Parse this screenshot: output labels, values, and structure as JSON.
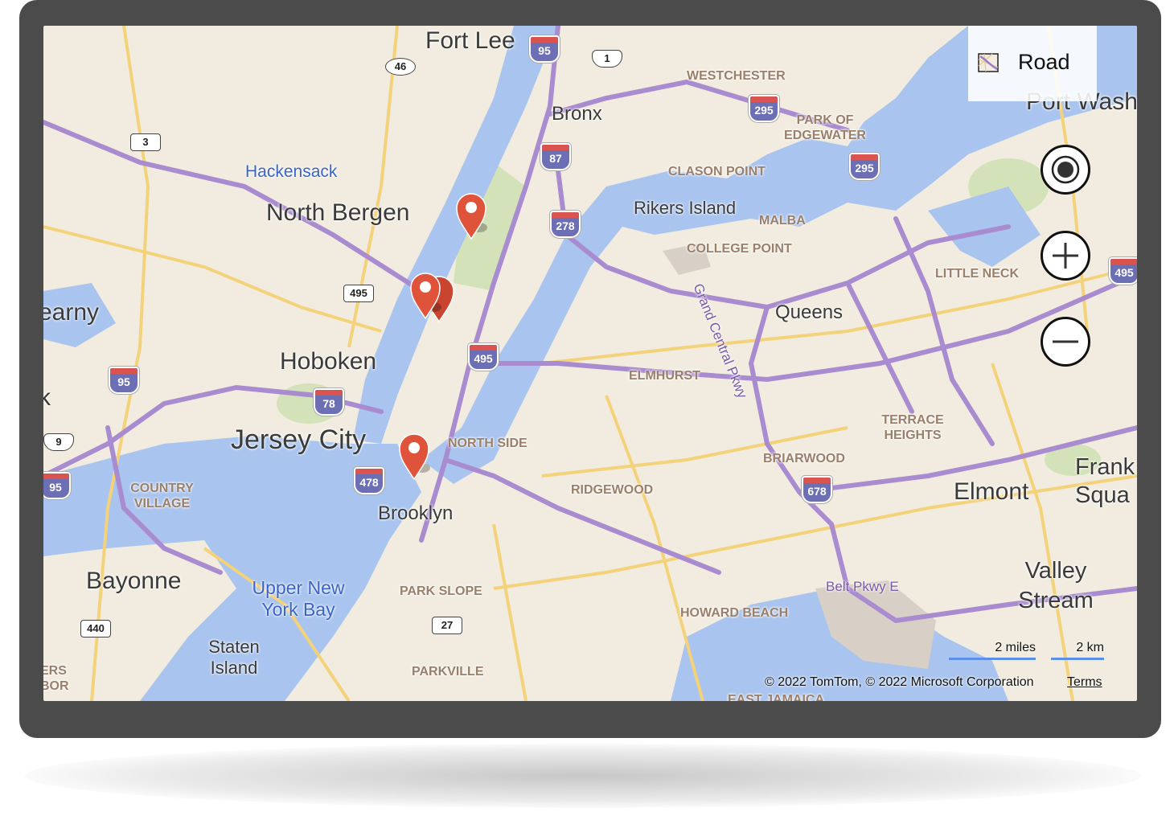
{
  "map": {
    "style_label": "Road",
    "style_icon": "road-map-style-icon",
    "controls": [
      {
        "name": "locate-me-button",
        "icon": "target-icon"
      },
      {
        "name": "zoom-in-button",
        "icon": "plus-icon"
      },
      {
        "name": "zoom-out-button",
        "icon": "minus-icon"
      }
    ],
    "cities": [
      "Fort Lee",
      "Bronx",
      "North Bergen",
      "Hoboken",
      "Jersey City",
      "Brooklyn",
      "Bayonne",
      "Queens",
      "Elmont",
      "Port Washin",
      "earny",
      "k"
    ],
    "towns": [
      "Rikers Island",
      "Staten Island",
      "Valley Stream",
      "Frank Squa"
    ],
    "neighborhoods": [
      "WESTCHESTER",
      "PARK OF EDGEWATER",
      "CLASON POINT",
      "MALBA",
      "COLLEGE POINT",
      "LITTLE NECK",
      "ELMHURST",
      "NORTH SIDE",
      "TERRACE HEIGHTS",
      "BRIARWOOD",
      "RIDGEWOOD",
      "COUNTRY VILLAGE",
      "PARK SLOPE",
      "HOWARD BEACH",
      "PARKVILLE",
      "EAST JAMAICA",
      "ERS BOR"
    ],
    "water_labels": [
      "Upper New York Bay"
    ],
    "blue_labels": [
      "Hackensack"
    ],
    "road_labels": [
      "Grand Central Pkwy",
      "Belt Pkwy E"
    ],
    "interstate_shields": [
      "95",
      "295",
      "295",
      "87",
      "278",
      "495",
      "495",
      "78",
      "478",
      "678",
      "95",
      "95"
    ],
    "route_shields": [
      "46",
      "1",
      "3",
      "495",
      "9",
      "440",
      "27"
    ],
    "pins": [
      {
        "name": "location-pin-1",
        "color": "#e0533b"
      },
      {
        "name": "location-pin-2",
        "color": "#e0533b"
      },
      {
        "name": "location-pin-3",
        "color": "#e0533b"
      },
      {
        "name": "location-pin-4",
        "color": "#e0533b"
      }
    ],
    "scale": {
      "miles": "2 miles",
      "km": "2 km"
    },
    "attribution": "© 2022 TomTom, © 2022 Microsoft Corporation",
    "terms_label": "Terms"
  },
  "colors": {
    "land": "#f1ecdf",
    "water": "#a9c4ee",
    "highway": "#a98bd0",
    "major_road": "#f3d27a",
    "park": "#cfe0b4",
    "pin": "#e0533b",
    "frame": "#4b4b4b"
  }
}
